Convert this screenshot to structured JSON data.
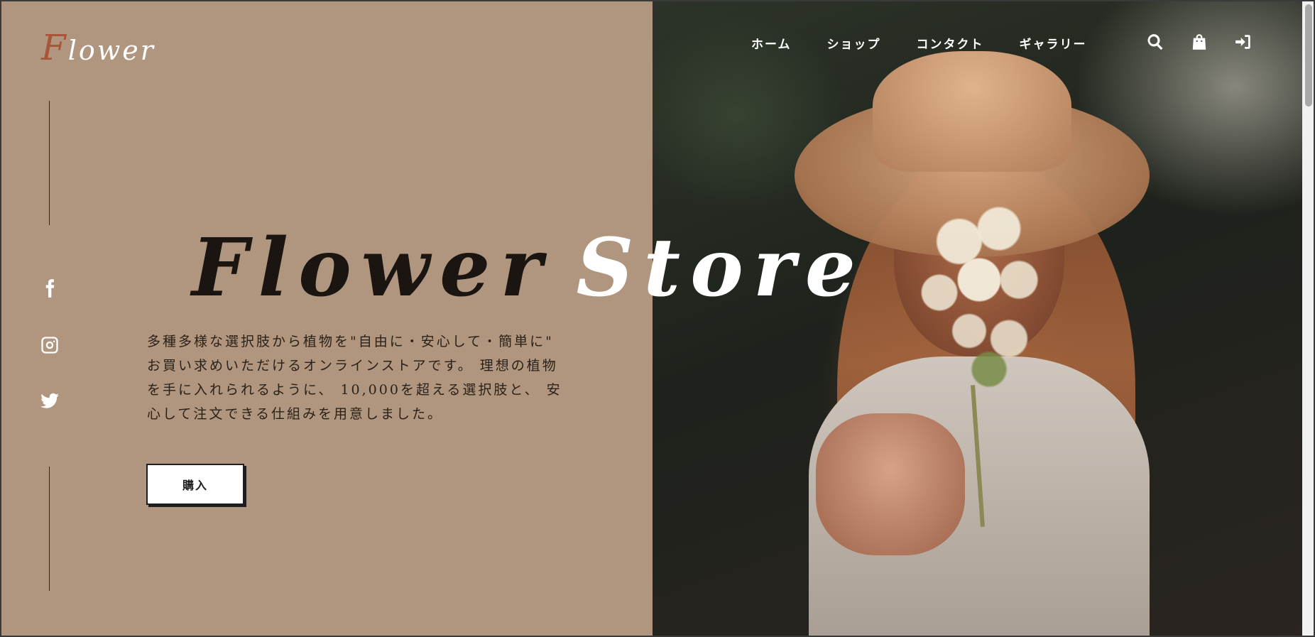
{
  "logo": {
    "first_letter": "F",
    "rest": "lower"
  },
  "nav": {
    "items": [
      {
        "label": "ホーム"
      },
      {
        "label": "ショップ"
      },
      {
        "label": "コンタクト"
      },
      {
        "label": "ギャラリー"
      }
    ],
    "icons": [
      "search-icon",
      "shopping-bag-icon",
      "sign-in-icon"
    ]
  },
  "social": [
    "facebook-icon",
    "instagram-icon",
    "twitter-icon"
  ],
  "hero": {
    "title_word1": "Flower",
    "title_word2": "Store",
    "description": "多種多様な選択肢から植物を\"自由に・安心して・簡単に\" お買い求めいただけるオンラインストアです。 理想の植物を手に入れられるように、 10,000を超える選択肢と、 安心して注文できる仕組みを用意しました。",
    "buy_label": "購入"
  },
  "colors": {
    "panel": "#b0967e",
    "logo_accent": "#a8553a",
    "text_dark": "#1a1510",
    "white": "#ffffff"
  }
}
